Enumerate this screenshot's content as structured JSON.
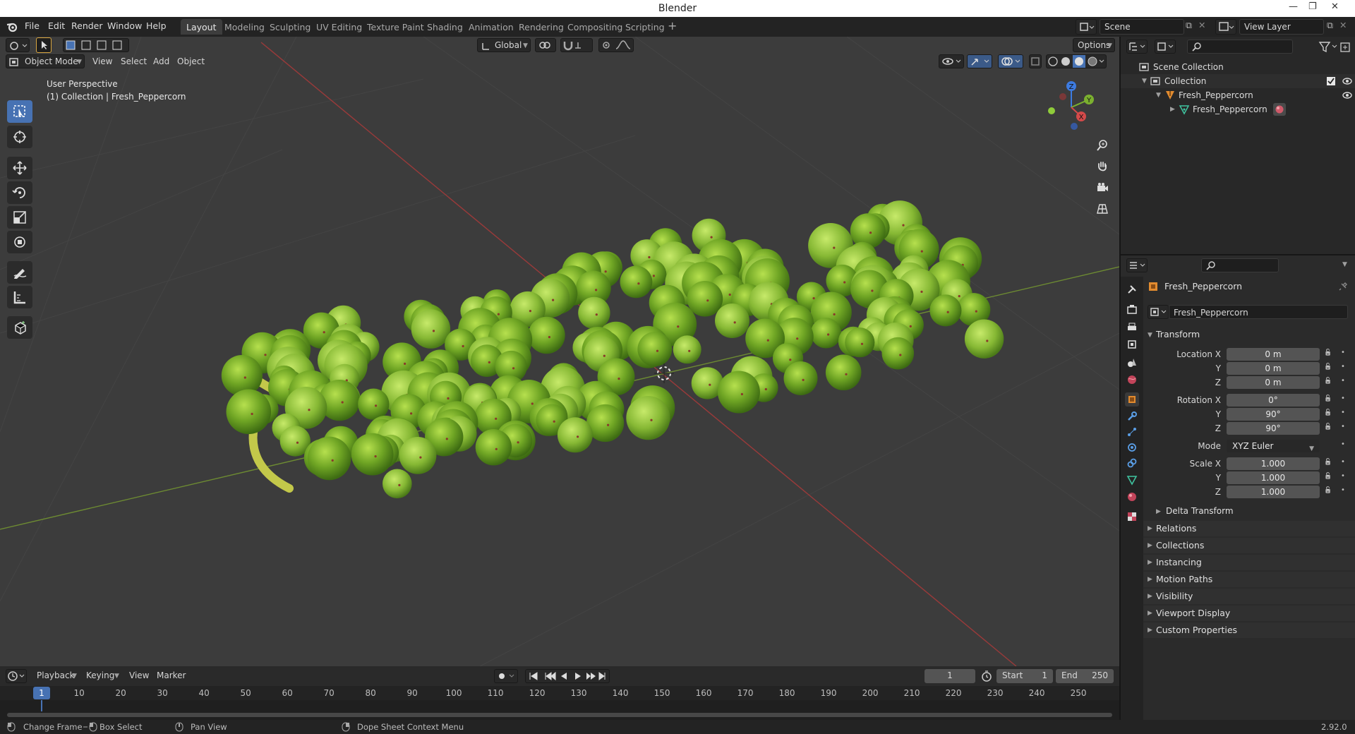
{
  "window": {
    "title": "Blender",
    "controls": [
      "—",
      "❐",
      "✕"
    ]
  },
  "menu": [
    "File",
    "Edit",
    "Render",
    "Window",
    "Help"
  ],
  "workspaces": [
    {
      "label": "Layout",
      "active": true
    },
    {
      "label": "Modeling"
    },
    {
      "label": "Sculpting"
    },
    {
      "label": "UV Editing"
    },
    {
      "label": "Texture Paint"
    },
    {
      "label": "Shading"
    },
    {
      "label": "Animation"
    },
    {
      "label": "Rendering"
    },
    {
      "label": "Compositing"
    },
    {
      "label": "Scripting"
    }
  ],
  "scene": {
    "name": "Scene",
    "view_layer": "View Layer"
  },
  "viewport": {
    "mode": "Object Mode",
    "menus": [
      "View",
      "Select",
      "Add",
      "Object"
    ],
    "transform_orientation": "Global",
    "options_label": "Options",
    "info_line1": "User Perspective",
    "info_line2": "(1) Collection | Fresh_Peppercorn",
    "gizmo_axes": [
      "Z",
      "Y",
      "X"
    ]
  },
  "timeline": {
    "menus": [
      "Playback",
      "Keying",
      "View",
      "Marker"
    ],
    "current_frame": "1",
    "start_label": "Start",
    "start": "1",
    "end_label": "End",
    "end": "250",
    "ticks": [
      "1",
      "10",
      "20",
      "30",
      "40",
      "50",
      "60",
      "70",
      "80",
      "90",
      "100",
      "110",
      "120",
      "130",
      "140",
      "150",
      "160",
      "170",
      "180",
      "190",
      "200",
      "210",
      "220",
      "230",
      "240",
      "250"
    ]
  },
  "statusbar": {
    "change_frame": "Change Frame",
    "box_select": "Box Select",
    "pan_view": "Pan View",
    "context_menu": "Dope Sheet Context Menu",
    "version": "2.92.0"
  },
  "outliner": {
    "scene_collection": "Scene Collection",
    "collection": "Collection",
    "object": "Fresh_Peppercorn",
    "mesh": "Fresh_Peppercorn"
  },
  "properties": {
    "object_name": "Fresh_Peppercorn",
    "data_name": "Fresh_Peppercorn",
    "transform_title": "Transform",
    "location_label": "Location X",
    "rotation_label": "Rotation X",
    "scale_label": "Scale X",
    "y_label": "Y",
    "z_label": "Z",
    "location": [
      "0 m",
      "0 m",
      "0 m"
    ],
    "rotation": [
      "0°",
      "90°",
      "90°"
    ],
    "mode_label": "Mode",
    "mode_value": "XYZ Euler",
    "scale": [
      "1.000",
      "1.000",
      "1.000"
    ],
    "delta_transform": "Delta Transform",
    "panels": [
      "Relations",
      "Collections",
      "Instancing",
      "Motion Paths",
      "Visibility",
      "Viewport Display",
      "Custom Properties"
    ]
  }
}
